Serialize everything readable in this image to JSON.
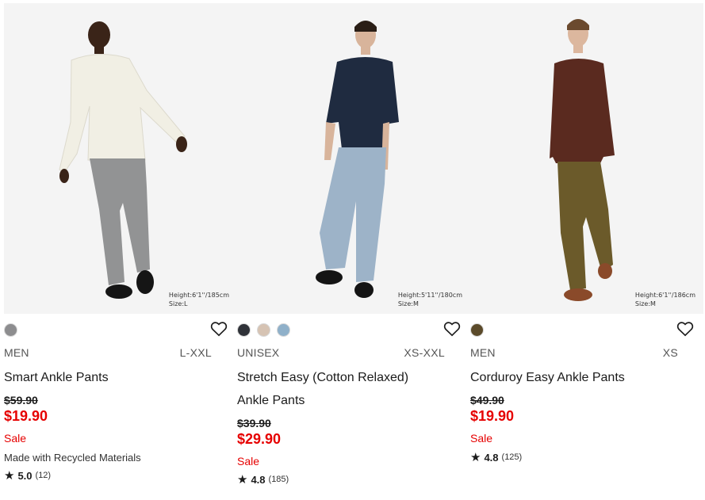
{
  "products": [
    {
      "height_line1": "Height:6'1''/185cm",
      "height_line2": "Size:L",
      "swatches": [
        "#8d8d8f"
      ],
      "gender": "MEN",
      "sizes": "L-XXL",
      "name_line1": "Smart Ankle Pants",
      "name_line2": "",
      "original_price": "$59.90",
      "price": "$19.90",
      "sale_label": "Sale",
      "note": "Made with Recycled Materials",
      "rating": "5.0",
      "review_count": "(12)"
    },
    {
      "height_line1": "Height:5'11''/180cm",
      "height_line2": "Size:M",
      "swatches": [
        "#2f3238",
        "#d6c3b3",
        "#8fb0c9"
      ],
      "gender": "UNISEX",
      "sizes": "XS-XXL",
      "name_line1": "Stretch Easy (Cotton Relaxed)",
      "name_line2": "Ankle Pants",
      "original_price": "$39.90",
      "price": "$29.90",
      "sale_label": "Sale",
      "note": "",
      "rating": "4.8",
      "review_count": "(185)"
    },
    {
      "height_line1": "Height:6'1''/186cm",
      "height_line2": "Size:M",
      "swatches": [
        "#5b4a2a"
      ],
      "gender": "MEN",
      "sizes": "XS",
      "name_line1": "Corduroy Easy Ankle Pants",
      "name_line2": "",
      "original_price": "$49.90",
      "price": "$19.90",
      "sale_label": "Sale",
      "note": "",
      "rating": "4.8",
      "review_count": "(125)"
    }
  ],
  "icons": {
    "wishlist": "heart-outline-icon",
    "rating": "star-icon"
  },
  "colors": {
    "sale_red": "#e60000",
    "text": "#1b1b1b"
  }
}
